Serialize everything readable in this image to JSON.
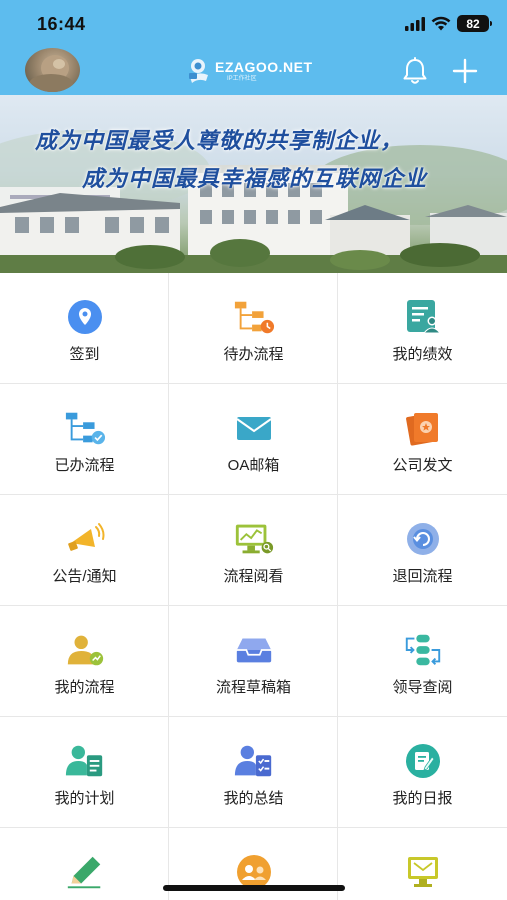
{
  "status_bar": {
    "time": "16:44",
    "battery": "82"
  },
  "header": {
    "logo_text": "EZAGOO.NET",
    "logo_sub": "IP工作社区"
  },
  "banner": {
    "slogan_line1": "成为中国最受人尊敬的共享制企业，",
    "slogan_line2": "成为中国最具幸福感的互联网企业"
  },
  "menu": [
    {
      "label": "签到",
      "icon": "location-pin-icon",
      "color": "#4a8ff0"
    },
    {
      "label": "待办流程",
      "icon": "flowchart-clock-icon",
      "color": "#f2a23a"
    },
    {
      "label": "我的绩效",
      "icon": "performance-doc-icon",
      "color": "#3aa7a0"
    },
    {
      "label": "已办流程",
      "icon": "flowchart-check-icon",
      "color": "#3a9bdc"
    },
    {
      "label": "OA邮箱",
      "icon": "mail-icon",
      "color": "#3aa7c8"
    },
    {
      "label": "公司发文",
      "icon": "document-seal-icon",
      "color": "#f07a2a"
    },
    {
      "label": "公告/通知",
      "icon": "megaphone-icon",
      "color": "#f2b42a"
    },
    {
      "label": "流程阅看",
      "icon": "monitor-chart-icon",
      "color": "#9cc23a"
    },
    {
      "label": "退回流程",
      "icon": "return-circle-icon",
      "color": "#5a8fe0"
    },
    {
      "label": "我的流程",
      "icon": "user-process-icon",
      "color": "#e0b23a"
    },
    {
      "label": "流程草稿箱",
      "icon": "inbox-tray-icon",
      "color": "#5a7fe0"
    },
    {
      "label": "领导查阅",
      "icon": "review-arrows-icon",
      "color": "#3ab8a0"
    },
    {
      "label": "我的计划",
      "icon": "user-plan-icon",
      "color": "#3ab89a"
    },
    {
      "label": "我的总结",
      "icon": "user-summary-icon",
      "color": "#5a7fe0"
    },
    {
      "label": "我的日报",
      "icon": "daily-report-icon",
      "color": "#2ab0a0"
    },
    {
      "label": "",
      "icon": "pencil-icon",
      "color": "#3aa86a"
    },
    {
      "label": "",
      "icon": "people-badge-icon",
      "color": "#f0a030"
    },
    {
      "label": "",
      "icon": "monitor-mail-icon",
      "color": "#c8c82a"
    }
  ]
}
